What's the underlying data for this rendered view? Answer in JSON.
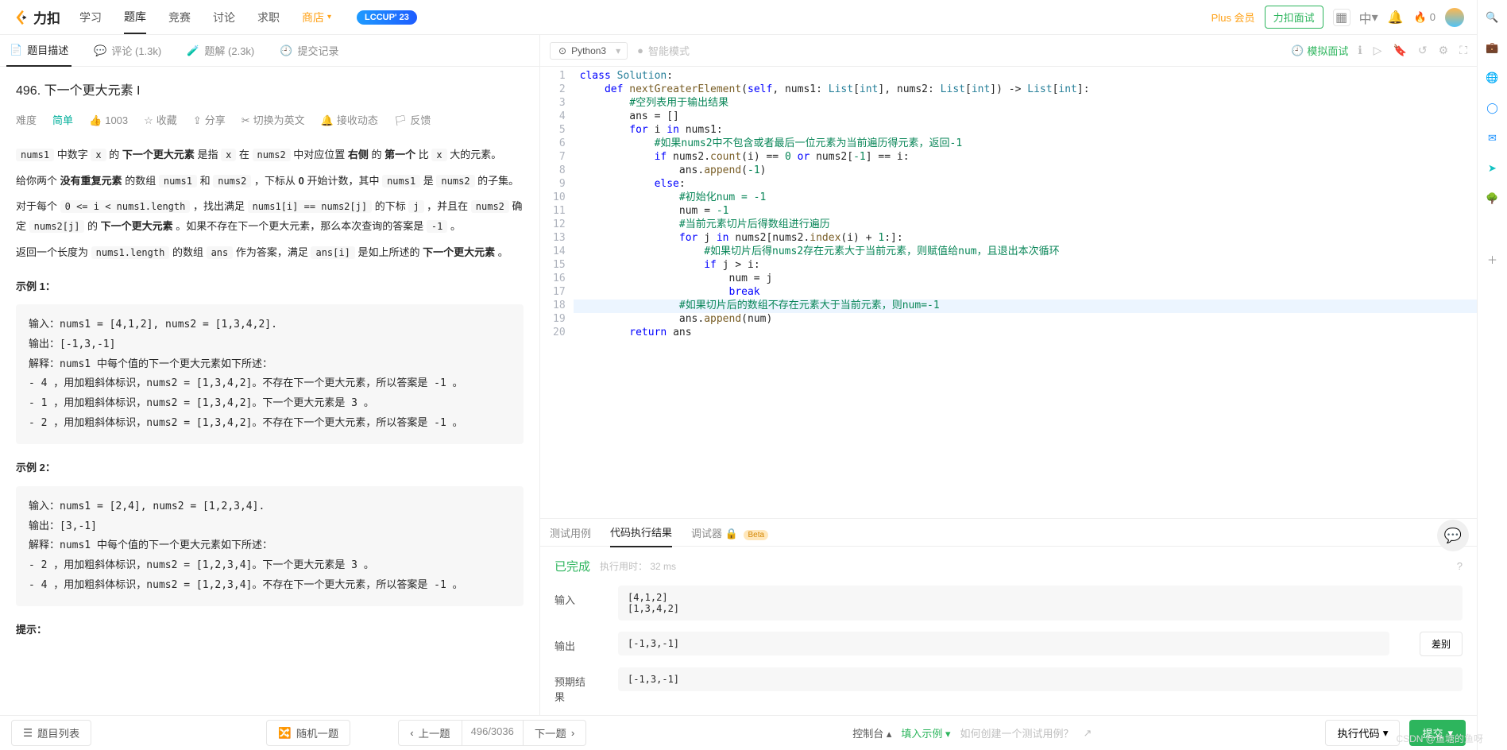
{
  "header": {
    "logo_text": "力扣",
    "nav": [
      "学习",
      "题库",
      "竞赛",
      "讨论",
      "求职",
      "商店"
    ],
    "lccup": "LCCUP' 23",
    "plus": "Plus 会员",
    "interview": "力扣面试",
    "lang_short": "中",
    "fire": "0"
  },
  "problem_tabs": {
    "desc": "题目描述",
    "comments": "评论 (1.3k)",
    "solutions": "题解 (2.3k)",
    "submissions": "提交记录"
  },
  "problem": {
    "title": "496. 下一个更大元素 I",
    "difficulty_label": "难度",
    "difficulty": "简单",
    "likes": "1003",
    "fav": "收藏",
    "share": "分享",
    "switch": "切换为英文",
    "notify": "接收动态",
    "feedback": "反馈"
  },
  "desc": {
    "p1_a": "nums1",
    "p1_b": "x",
    "p1_c": "下一个更大元素",
    "p1_d": "x",
    "p1_e": "nums2",
    "p1_f": "右侧",
    "p1_g": "第一个",
    "p1_h": "x",
    "p2_a": "没有重复元素",
    "p2_b": "nums1",
    "p2_c": "nums2",
    "p2_d": "0",
    "p2_e": "nums1",
    "p2_f": "nums2",
    "p3_a": "0 <= i < nums1.length",
    "p3_b": "nums1[i] == nums2[j]",
    "p3_c": "j",
    "p3_d": "nums2",
    "p3_e": "nums2[j]",
    "p3_f": "下一个更大元素",
    "p3_g": "-1",
    "p4_a": "nums1.length",
    "p4_b": "ans",
    "p4_c": "ans[i]",
    "p4_d": "下一个更大元素"
  },
  "examples": {
    "ex1_title": "示例 1：",
    "ex1": "输入：nums1 = [4,1,2], nums2 = [1,3,4,2].\n输出：[-1,3,-1]\n解释：nums1 中每个值的下一个更大元素如下所述：\n- 4 ，用加粗斜体标识，nums2 = [1,3,4,2]。不存在下一个更大元素，所以答案是 -1 。\n- 1 ，用加粗斜体标识，nums2 = [1,3,4,2]。下一个更大元素是 3 。\n- 2 ，用加粗斜体标识，nums2 = [1,3,4,2]。不存在下一个更大元素，所以答案是 -1 。",
    "ex2_title": "示例 2：",
    "ex2": "输入：nums1 = [2,4], nums2 = [1,2,3,4].\n输出：[3,-1]\n解释：nums1 中每个值的下一个更大元素如下所述：\n- 2 ，用加粗斜体标识，nums2 = [1,2,3,4]。下一个更大元素是 3 。\n- 4 ，用加粗斜体标识，nums2 = [1,2,3,4]。不存在下一个更大元素，所以答案是 -1 。",
    "hint_title": "提示："
  },
  "editor": {
    "language": "Python3",
    "ai_mode": "智能模式",
    "mock": "模拟面试"
  },
  "code_lines": [
    "class Solution:",
    "    def nextGreaterElement(self, nums1: List[int], nums2: List[int]) -> List[int]:",
    "        #空列表用于输出结果",
    "        ans = []",
    "        for i in nums1:",
    "            #如果nums2中不包含或者最后一位元素为当前遍历得元素，返回-1",
    "            if nums2.count(i) == 0 or nums2[-1] == i:",
    "                ans.append(-1)",
    "            else:",
    "                #初始化num = -1",
    "                num = -1",
    "                #当前元素切片后得数组进行遍历",
    "                for j in nums2[nums2.index(i) + 1:]:",
    "                    #如果切片后得nums2存在元素大于当前元素，则赋值给num，且退出本次循环",
    "                    if j > i:",
    "                        num = j",
    "                        break",
    "                #如果切片后的数组不存在元素大于当前元素，则num=-1",
    "                ans.append(num)",
    "        return ans"
  ],
  "result_tabs": {
    "testcase": "测试用例",
    "result": "代码执行结果",
    "debugger": "调试器",
    "beta": "Beta"
  },
  "result": {
    "status": "已完成",
    "runtime_label": "执行用时：",
    "runtime": "32 ms",
    "input_label": "输入",
    "input_val": "[4,1,2]\n[1,3,4,2]",
    "output_label": "输出",
    "output_val": "[-1,3,-1]",
    "expected_label": "预期结果",
    "expected_val": "[-1,3,-1]",
    "diff": "差别"
  },
  "bottom": {
    "list": "题目列表",
    "random": "随机一题",
    "prev": "上一题",
    "counter": "496/3036",
    "next": "下一题",
    "console": "控制台",
    "fill_example": "填入示例",
    "how_to": "如何创建一个测试用例？",
    "run": "执行代码",
    "submit": "提交"
  },
  "watermark": "CSDN @鱼塘的鱼呀"
}
